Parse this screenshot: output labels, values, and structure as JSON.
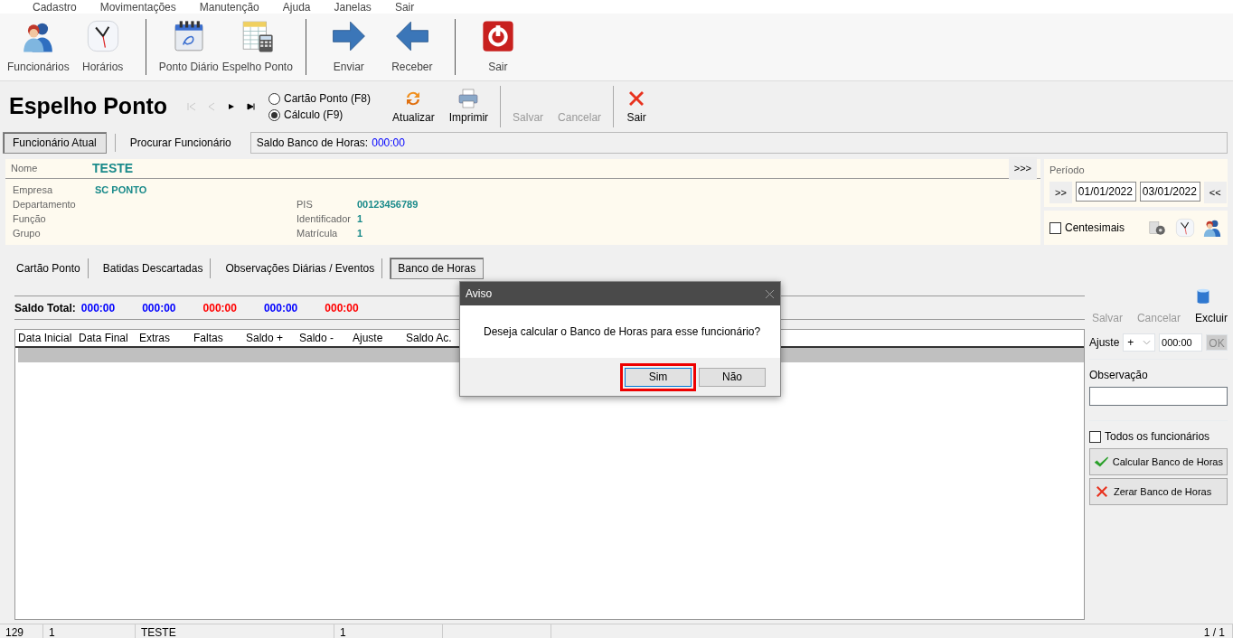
{
  "menu": [
    {
      "label": "Cadastro"
    },
    {
      "label": "Movimentações"
    },
    {
      "label": "Manutenção"
    },
    {
      "label": "Ajuda"
    },
    {
      "label": "Janelas"
    },
    {
      "label": "Sair"
    }
  ],
  "toolbar_groups": [
    [
      {
        "label": "Funcionários",
        "kind": "people"
      },
      {
        "label": "Horários",
        "kind": "clock"
      }
    ],
    [
      {
        "label": "Ponto Diário",
        "kind": "calendar"
      },
      {
        "label": "Espelho Ponto",
        "kind": "sheet"
      }
    ],
    [
      {
        "label": "Enviar",
        "kind": "arrow_right"
      },
      {
        "label": "Receber",
        "kind": "arrow_left"
      }
    ],
    [
      {
        "label": "Sair",
        "kind": "power"
      }
    ]
  ],
  "form": {
    "title": "Espelho Ponto",
    "nav": [
      {
        "kind": "first",
        "disabled": true
      },
      {
        "kind": "prev",
        "disabled": true
      },
      {
        "kind": "next",
        "disabled": false
      },
      {
        "kind": "last",
        "disabled": false
      }
    ],
    "mode_options": [
      {
        "label": "Cartão Ponto (F8)",
        "selected": false
      },
      {
        "label": "Cálculo (F9)",
        "selected": true
      }
    ],
    "actions": [
      {
        "label": "Atualizar",
        "kind": "refresh",
        "disabled": false
      },
      {
        "label": "Imprimir",
        "kind": "print",
        "disabled": false
      },
      {
        "label": "Salvar",
        "kind": "text",
        "disabled": true
      },
      {
        "label": "Cancelar",
        "kind": "text",
        "disabled": true
      },
      {
        "label": "Sair",
        "kind": "close",
        "disabled": false
      }
    ]
  },
  "employee_tabs": [
    {
      "label": "Funcionário Atual",
      "selected": true
    },
    {
      "label": "Procurar Funcionário",
      "selected": false
    }
  ],
  "balance": {
    "label": "Saldo Banco de Horas:",
    "value": "000:00"
  },
  "employee": {
    "name_label": "Nome",
    "name": "TESTE",
    "expand": ">>>",
    "fields_left": [
      {
        "label": "Empresa",
        "value": "SC PONTO"
      },
      {
        "label": "Departamento"
      },
      {
        "label": "Função"
      },
      {
        "label": "Grupo"
      }
    ],
    "fields_right": [
      {
        "label": "PIS",
        "value": "00123456789"
      },
      {
        "label": "Identificador",
        "value": "1"
      },
      {
        "label": "Matrícula",
        "value": "1"
      }
    ]
  },
  "period": {
    "label": "Período",
    "back": ">>",
    "from": "01/01/2022",
    "to": "03/01/2022",
    "forward": "<<"
  },
  "centesimais": {
    "label": "Centesimais",
    "checked": false
  },
  "tabs": [
    {
      "label": "Cartão Ponto",
      "selected": false
    },
    {
      "label": "Batidas Descartadas",
      "selected": false
    },
    {
      "label": "Observações Diárias / Eventos",
      "selected": false
    },
    {
      "label": "Banco de Horas",
      "selected": true
    }
  ],
  "saldo_total": {
    "label": "Saldo Total:",
    "values": [
      {
        "value": "000:00",
        "color": "#0000ff"
      },
      {
        "value": "000:00",
        "color": "#0000ff"
      },
      {
        "value": "000:00",
        "color": "#ff0000"
      },
      {
        "value": "000:00",
        "color": "#0000ff"
      },
      {
        "value": "000:00",
        "color": "#ff0000"
      }
    ]
  },
  "grid": {
    "columns": [
      "Data Inicial",
      "Data Final",
      "Extras",
      "Faltas",
      "Saldo +",
      "Saldo -",
      "Ajuste",
      "Saldo Ac."
    ]
  },
  "side": {
    "actions": [
      {
        "label": "Salvar",
        "disabled": true
      },
      {
        "label": "Cancelar",
        "disabled": true
      },
      {
        "label": "Excluir",
        "disabled": false
      }
    ],
    "ajuste_label": "Ajuste",
    "sign": "+",
    "time": "000:00",
    "ok": {
      "label": "OK",
      "disabled": true
    },
    "obs_label": "Observação",
    "all": {
      "label": "Todos os funcionários",
      "checked": false
    },
    "buttons": [
      {
        "label": "Calcular Banco de Horas",
        "kind": "check"
      },
      {
        "label": "Zerar Banco de Horas",
        "kind": "cross"
      }
    ]
  },
  "dialog": {
    "title": "Aviso",
    "message": "Deseja calcular o Banco de Horas para esse funcionário?",
    "buttons": [
      {
        "label": "Sim",
        "highlighted": true
      },
      {
        "label": "Não",
        "highlighted": false
      }
    ]
  },
  "status_bar": [
    {
      "text": "129"
    },
    {
      "text": "1"
    },
    {
      "text": "TESTE"
    },
    {
      "text": "1"
    },
    {
      "text": "1 / 1"
    }
  ]
}
